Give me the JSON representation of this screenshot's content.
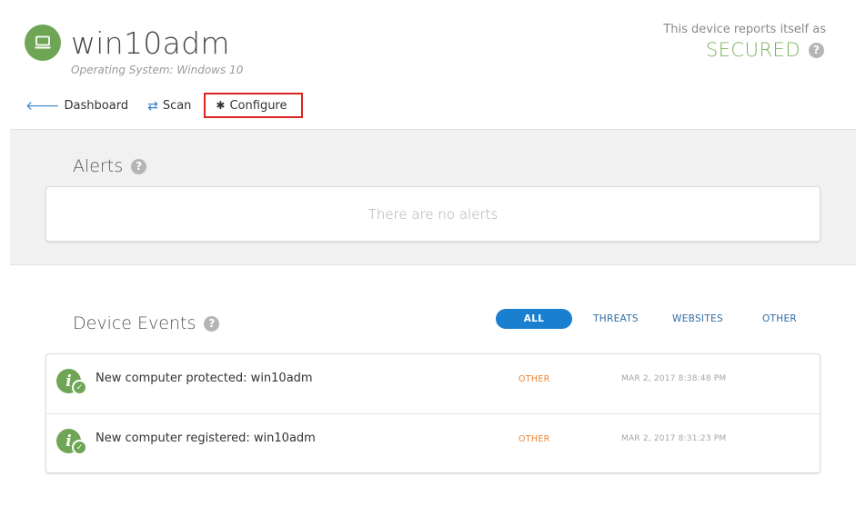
{
  "device": {
    "name": "win10adm",
    "os_label": "Operating System: Windows 10",
    "icon": "laptop-icon",
    "accent_color": "#6ea655"
  },
  "status": {
    "caption": "This device reports itself as",
    "value": "SECURED",
    "help": "?",
    "color": "#7bb35f"
  },
  "nav": {
    "dashboard": {
      "icon_glyph": "🡐",
      "label": "Dashboard"
    },
    "scan": {
      "icon_glyph": "⇄",
      "label": "Scan"
    },
    "configure": {
      "icon_glyph": "✱",
      "label": "Configure"
    }
  },
  "alerts": {
    "title": "Alerts",
    "help": "?",
    "empty_message": "There are no alerts"
  },
  "events": {
    "title": "Device Events",
    "help": "?",
    "filters": [
      {
        "label": "ALL",
        "active": true
      },
      {
        "label": "THREATS",
        "active": false
      },
      {
        "label": "WEBSITES",
        "active": false
      },
      {
        "label": "OTHER",
        "active": false
      }
    ],
    "rows": [
      {
        "icon": "info-check-icon",
        "info_glyph": "i",
        "check_glyph": "✓",
        "text": "New computer protected: win10adm",
        "type": "OTHER",
        "time": "MAR 2, 2017 8:38:48 PM"
      },
      {
        "icon": "info-check-icon",
        "info_glyph": "i",
        "check_glyph": "✓",
        "text": "New computer registered: win10adm",
        "type": "OTHER",
        "time": "MAR 2, 2017 8:31:23 PM"
      }
    ]
  },
  "colors": {
    "primary_blue": "#1b7fd0",
    "link_blue": "#2e6da4",
    "other_orange": "#e8843a",
    "highlight_red": "#d9231f"
  }
}
